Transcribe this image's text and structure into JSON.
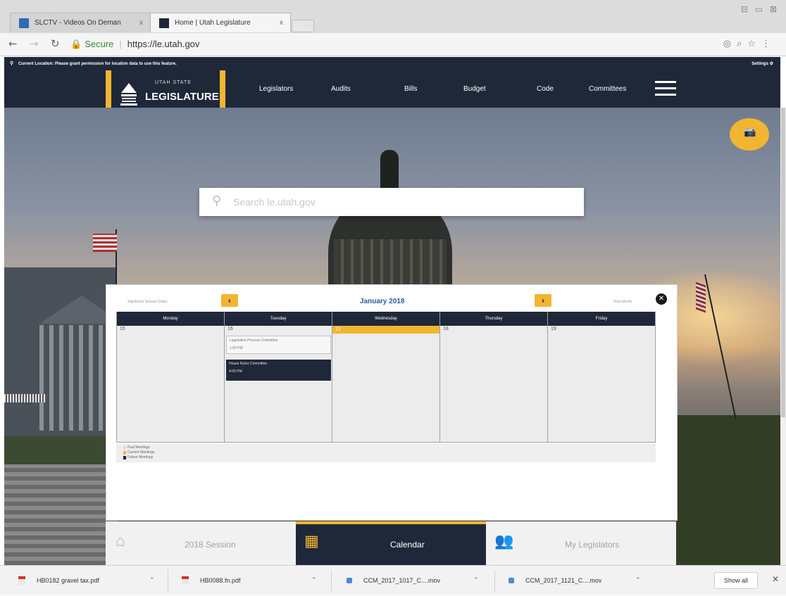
{
  "browser": {
    "tabs": [
      {
        "title": "SLCTV - Videos On Deman",
        "close": "x"
      },
      {
        "title": "Home | Utah Legislature",
        "close": "x"
      }
    ],
    "url_secure_label": "Secure",
    "url": "https://le.utah.gov",
    "window_controls": "⊟ ▭ ⊠"
  },
  "site": {
    "location_notice": "Current Location: Please grant permission for location data to use this feature.",
    "settings_label": "Settings",
    "logo": {
      "small": "UTAH STATE",
      "big": "LEGISLATURE"
    },
    "nav": [
      "Legislators",
      "Audits",
      "Bills",
      "Budget",
      "Code",
      "Committees"
    ],
    "search_placeholder": "Search le.utah.gov"
  },
  "calendar": {
    "significant_dates_label": "Significant Session Dates",
    "view_month_label": "View Month",
    "month_title": "January 2018",
    "prev": "‹",
    "next": "›",
    "close": "✕",
    "days": [
      {
        "name": "Monday",
        "num": "15"
      },
      {
        "name": "Tuesday",
        "num": "16"
      },
      {
        "name": "Wednesday",
        "num": "17"
      },
      {
        "name": "Thursday",
        "num": "18"
      },
      {
        "name": "Friday",
        "num": "19"
      }
    ],
    "events": [
      {
        "title": "Legislative Process Committee",
        "time": "1:00 PM"
      },
      {
        "title": "House Rules Committee",
        "time": "4:00 PM"
      }
    ],
    "legend": [
      {
        "label": "Past Meetings",
        "color": "#dddddd"
      },
      {
        "label": "Current Meetings",
        "color": "#f2b531"
      },
      {
        "label": "Future Meetings",
        "color": "#1f2838"
      }
    ]
  },
  "bottom_nav": [
    {
      "label": "2018 Session"
    },
    {
      "label": "Calendar"
    },
    {
      "label": "My Legislators"
    }
  ],
  "downloads": [
    {
      "name": "HB0182 gravel tax.pdf"
    },
    {
      "name": "HB0088.fn.pdf"
    },
    {
      "name": "CCM_2017_1017_C....mov"
    },
    {
      "name": "CCM_2017_1121_C....mov"
    }
  ],
  "shelf": {
    "show_all": "Show all",
    "close": "✕"
  },
  "colors": {
    "navy": "#1f2838",
    "gold": "#f2b531",
    "link_blue": "#2b5b9c"
  }
}
